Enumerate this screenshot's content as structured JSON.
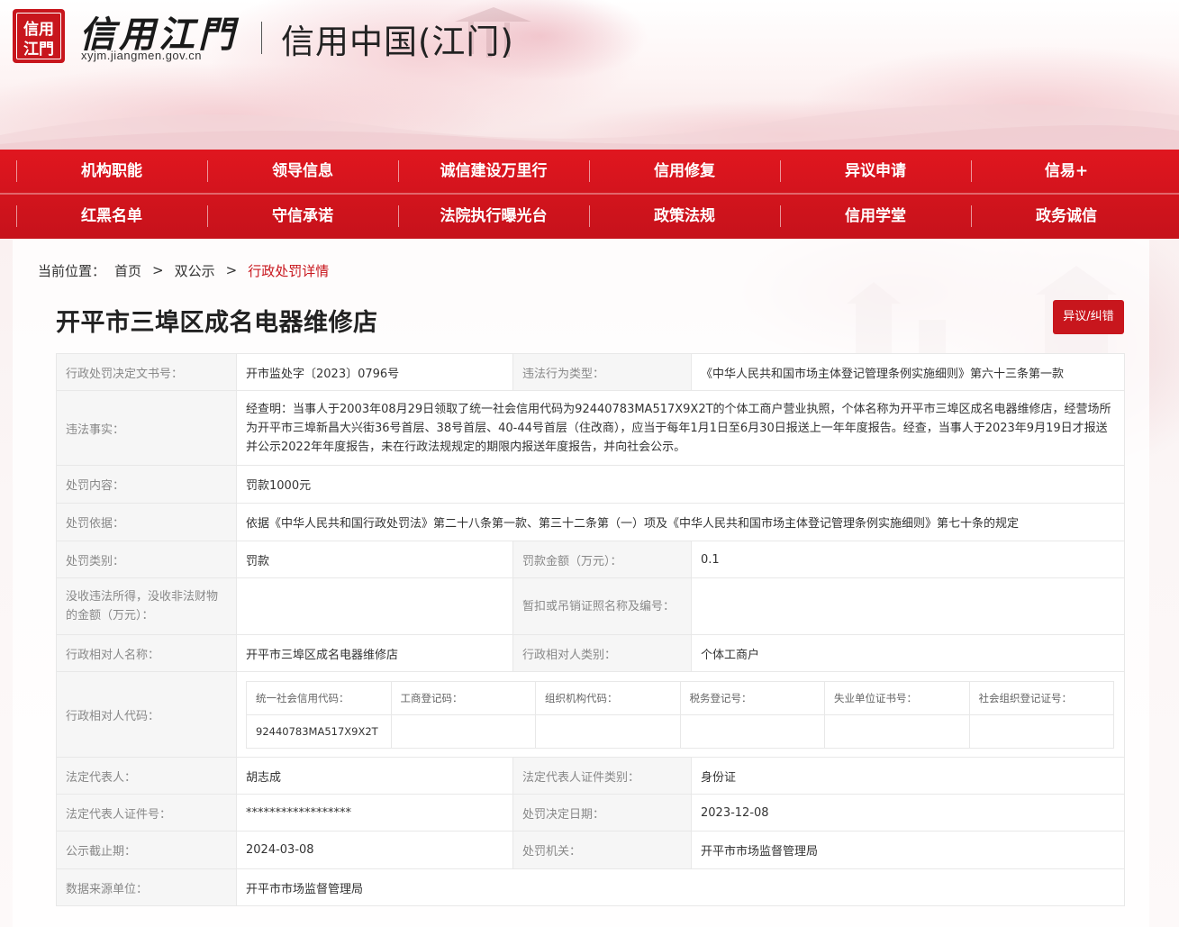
{
  "header": {
    "brand_calligraphy": "信用江門",
    "seal_text": "信用江門",
    "url": "xyjm.jiangmen.gov.cn",
    "subtitle": "信用中国(江门)"
  },
  "nav": {
    "row1": [
      "机构职能",
      "领导信息",
      "诚信建设万里行",
      "信用修复",
      "异议申请",
      "信易+"
    ],
    "row2": [
      "红黑名单",
      "守信承诺",
      "法院执行曝光台",
      "政策法规",
      "信用学堂",
      "政务诚信"
    ]
  },
  "breadcrumb": {
    "prefix": "当前位置：",
    "home": "首页",
    "sep": ">",
    "section": "双公示",
    "current": "行政处罚详情"
  },
  "title": "开平市三埠区成名电器维修店",
  "objection_button": "异议/纠错",
  "detail": {
    "decision_no_label": "行政处罚决定文书号：",
    "decision_no": "开市监处字〔2023〕0796号",
    "violation_type_label": "违法行为类型：",
    "violation_type": "《中华人民共和国市场主体登记管理条例实施细则》第六十三条第一款",
    "facts_label": "违法事实：",
    "facts": "经查明：当事人于2003年08月29日领取了统一社会信用代码为92440783MA517X9X2T的个体工商户营业执照，个体名称为开平市三埠区成名电器维修店，经营场所为开平市三埠新昌大兴街36号首层、38号首层、40-44号首层（住改商），应当于每年1月1日至6月30日报送上一年年度报告。经查，当事人于2023年9月19日才报送并公示2022年年度报告，未在行政法规规定的期限内报送年度报告，并向社会公示。",
    "content_label": "处罚内容：",
    "content": "罚款1000元",
    "basis_label": "处罚依据：",
    "basis": "依据《中华人民共和国行政处罚法》第二十八条第一款、第三十二条第（一）项及《中华人民共和国市场主体登记管理条例实施细则》第七十条的规定",
    "category_label": "处罚类别：",
    "category": "罚款",
    "fine_amount_label": "罚款金额（万元）：",
    "fine_amount": "0.1",
    "confiscated_label": "没收违法所得，没收非法财物的金额（万元）：",
    "confiscated": "",
    "license_label": "暂扣或吊销证照名称及编号：",
    "license": "",
    "party_name_label": "行政相对人名称：",
    "party_name": "开平市三埠区成名电器维修店",
    "party_type_label": "行政相对人类别：",
    "party_type": "个体工商户",
    "party_code_label": "行政相对人代码：",
    "codes": {
      "headers": [
        "统一社会信用代码：",
        "工商登记码：",
        "组织机构代码：",
        "税务登记号：",
        "失业单位证书号：",
        "社会组织登记证号："
      ],
      "values": [
        "92440783MA517X9X2T",
        "",
        "",
        "",
        "",
        ""
      ]
    },
    "legal_rep_label": "法定代表人：",
    "legal_rep": "胡志成",
    "legal_rep_id_type_label": "法定代表人证件类别：",
    "legal_rep_id_type": "身份证",
    "legal_rep_id_no_label": "法定代表人证件号：",
    "legal_rep_id_no": "******************",
    "decision_date_label": "处罚决定日期：",
    "decision_date": "2023-12-08",
    "publicity_deadline_label": "公示截止期：",
    "publicity_deadline": "2024-03-08",
    "authority_label": "处罚机关：",
    "authority": "开平市市场监督管理局",
    "data_source_label": "数据来源单位：",
    "data_source": "开平市市场监督管理局"
  },
  "colors": {
    "brand_red": "#c8161d",
    "nav_red": "#d9141c",
    "label_bg": "#f6f6f6",
    "label_text": "#888888"
  }
}
